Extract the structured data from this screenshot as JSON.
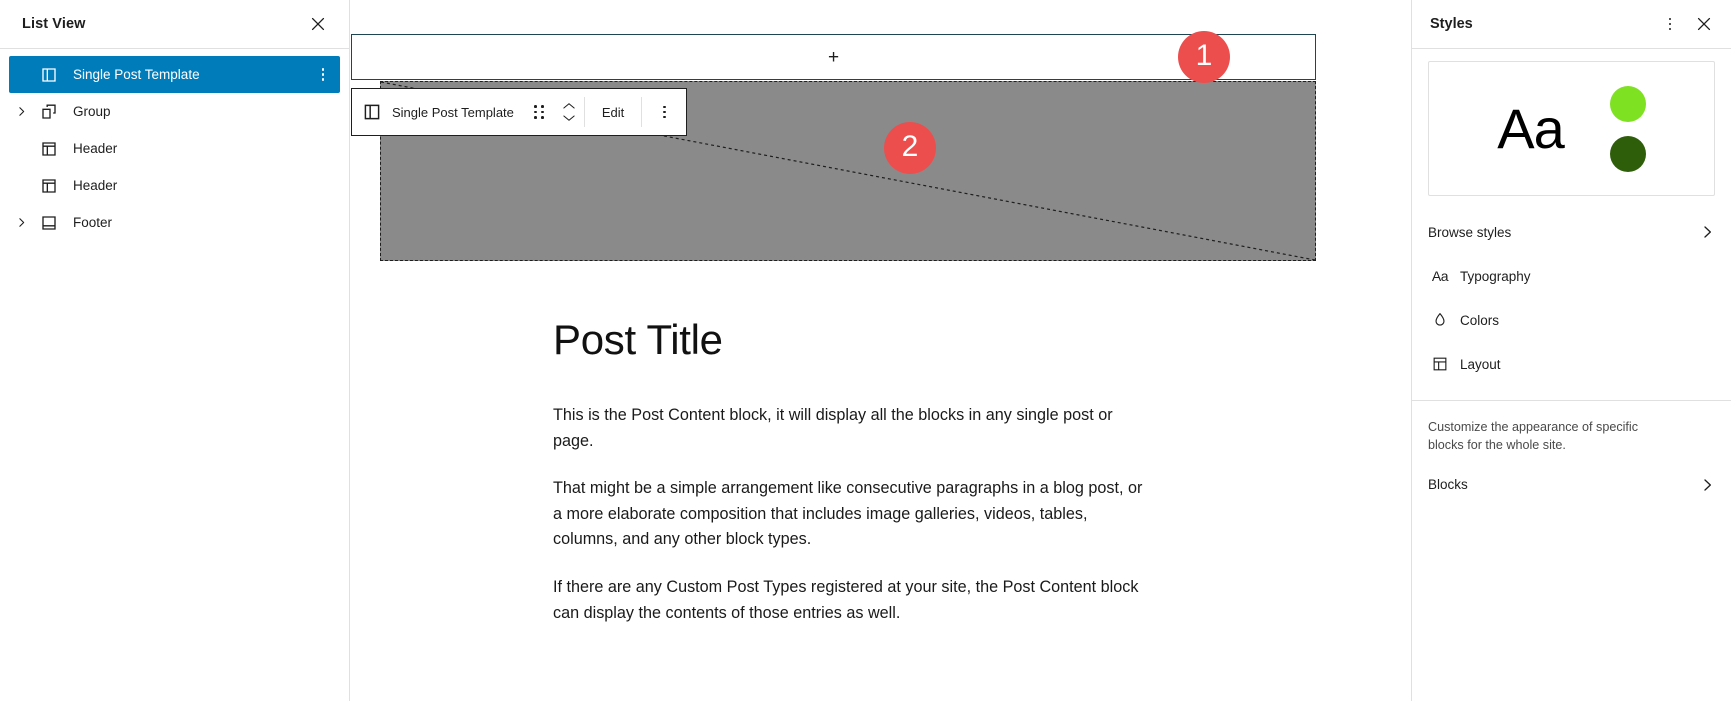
{
  "list_view": {
    "title": "List View",
    "close_icon": "close-icon",
    "items": [
      {
        "label": "Single Post Template",
        "icon": "template-part-icon",
        "selected": true,
        "expandable": false,
        "has_menu": true
      },
      {
        "label": "Group",
        "icon": "group-icon",
        "selected": false,
        "expandable": true,
        "has_menu": false
      },
      {
        "label": "Header",
        "icon": "template-part-icon",
        "selected": false,
        "expandable": false,
        "has_menu": false
      },
      {
        "label": "Header",
        "icon": "template-part-icon",
        "selected": false,
        "expandable": false,
        "has_menu": false
      },
      {
        "label": "Footer",
        "icon": "footer-icon",
        "selected": false,
        "expandable": true,
        "has_menu": false
      }
    ]
  },
  "canvas": {
    "appender": {
      "icon": "plus-icon",
      "label": "+"
    },
    "block_toolbar": {
      "block_icon": "template-part-icon",
      "block_name": "Single Post Template",
      "drag_icon": "drag-handle-icon",
      "mover_up_icon": "chevron-up-icon",
      "mover_down_icon": "chevron-down-icon",
      "edit_label": "Edit",
      "more_icon": "more-vertical-icon"
    },
    "post": {
      "title": "Post Title",
      "paragraphs": [
        "This is the Post Content block, it will display all the blocks in any single post or page.",
        "That might be a simple arrangement like consecutive paragraphs in a blog post, or a more elaborate composition that includes image galleries, videos, tables, columns, and any other block types.",
        "If there are any Custom Post Types registered at your site, the Post Content block can display the contents of those entries as well."
      ]
    }
  },
  "styles_panel": {
    "title": "Styles",
    "more_icon": "more-vertical-icon",
    "close_icon": "close-icon",
    "preview": {
      "sample_text": "Aa",
      "swatches": [
        "#7ee122",
        "#2f5e0a"
      ]
    },
    "browse": {
      "label": "Browse styles",
      "chevron": "chevron-right-icon"
    },
    "sections": [
      {
        "label": "Typography",
        "icon": "typography-icon"
      },
      {
        "label": "Colors",
        "icon": "color-drop-icon"
      },
      {
        "label": "Layout",
        "icon": "layout-icon"
      }
    ],
    "description": "Customize the appearance of specific blocks for the whole site.",
    "blocks": {
      "label": "Blocks",
      "chevron": "chevron-right-icon"
    }
  },
  "annotations": [
    {
      "number": "1",
      "color": "#ec4e4e"
    },
    {
      "number": "2",
      "color": "#ec4e4e"
    }
  ]
}
